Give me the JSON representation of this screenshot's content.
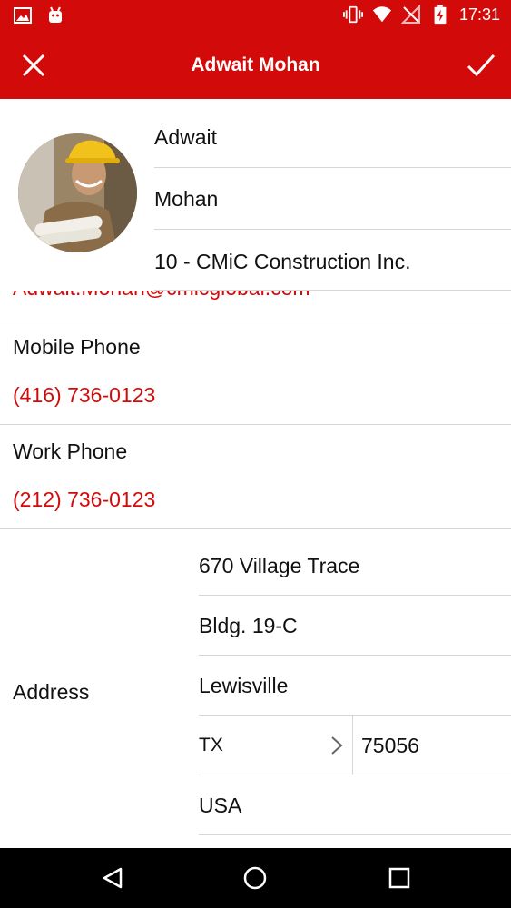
{
  "status_bar": {
    "time": "17:31",
    "left_icons": [
      "image-icon",
      "android-icon"
    ],
    "right_icons": [
      "vibrate-icon",
      "wifi-icon",
      "no-signal-icon",
      "battery-charging-icon"
    ]
  },
  "app_bar": {
    "title": "Adwait Mohan",
    "close_icon": "close-icon",
    "done_icon": "check-icon"
  },
  "contact": {
    "first_name": "Adwait",
    "last_name": "Mohan",
    "company": "10 - CMiC Construction Inc.",
    "email": "Adwait.Mohan@cmicglobal.com",
    "mobile_phone_label": "Mobile Phone",
    "mobile_phone": "(416) 736-0123",
    "work_phone_label": "Work Phone",
    "work_phone": "(212) 736-0123",
    "address_label": "Address",
    "address": {
      "line1": "670 Village Trace",
      "line2": "Bldg. 19-C",
      "city": "Lewisville",
      "state": "TX",
      "zip": "75056",
      "country": "USA"
    }
  },
  "nav_bar": {
    "icons": [
      "back-icon",
      "home-icon",
      "recents-icon"
    ]
  },
  "colors": {
    "accent": "#d30a0a",
    "divider": "#d6d6d6",
    "nav_bar": "#000000"
  }
}
